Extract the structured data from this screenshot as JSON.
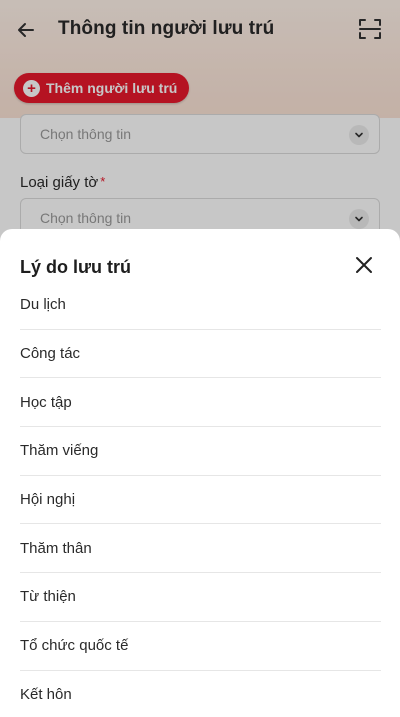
{
  "header": {
    "title": "Thông tin người lưu trú",
    "add_button_label": "Thêm người lưu trú",
    "add_icon": "+"
  },
  "form": {
    "select_placeholder_1": "Chọn thông tin",
    "document_type_label": "Loại giấy tờ",
    "required_marker": "*",
    "select_placeholder_2": "Chọn thông tin"
  },
  "sheet": {
    "title": "Lý do lưu trú",
    "options": [
      "Du lịch",
      "Công tác",
      "Học tập",
      "Thăm viếng",
      "Hội nghị",
      "Thăm thân",
      "Từ thiện",
      "Tổ chức quốc tế",
      "Kết hôn"
    ]
  },
  "colors": {
    "accent": "#e8192c",
    "overlay": "rgba(0,0,0,0.22)"
  },
  "icons": {
    "back": "back-arrow-icon",
    "scan": "scan-icon",
    "add": "plus-circle-icon",
    "chevron": "chevron-down-icon",
    "close": "close-icon"
  }
}
